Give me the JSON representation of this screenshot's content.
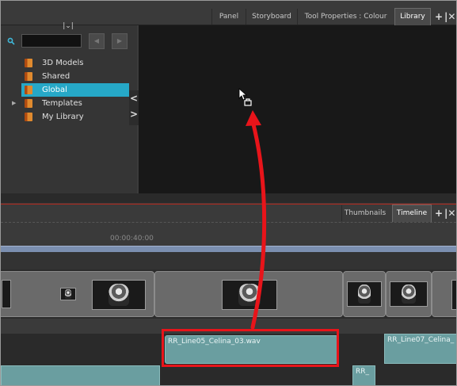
{
  "top_tabs": {
    "panel": "Panel",
    "storyboard": "Storyboard",
    "tool_properties": "Tool Properties : Colour",
    "library": "Library",
    "add_icon": "plus-icon",
    "close_icon": "close-icon"
  },
  "library": {
    "search": {
      "value": "",
      "placeholder": ""
    },
    "tree": [
      {
        "label": "3D Models",
        "icon": "folder-icon",
        "selected": false,
        "expandable": false
      },
      {
        "label": "Shared",
        "icon": "folder-icon",
        "selected": false,
        "expandable": false
      },
      {
        "label": "Global",
        "icon": "folder-icon",
        "selected": true,
        "expandable": false
      },
      {
        "label": "Templates",
        "icon": "folder-icon",
        "selected": false,
        "expandable": true
      },
      {
        "label": "My Library",
        "icon": "folder-icon",
        "selected": false,
        "expandable": false
      }
    ],
    "selection_color": "#26a8c7",
    "collapse_glyphs": {
      "top": "<",
      "bottom": ">"
    }
  },
  "timeline_tabs": {
    "thumbnails": "Thumbnails",
    "timeline": "Timeline",
    "add_icon": "plus-icon",
    "close_icon": "close-icon"
  },
  "timeline": {
    "timecode": "00:00:40:00",
    "audio_clips": [
      {
        "label": "RR_Line05_Celina_03.wav"
      },
      {
        "label": "RR_Line07_Celina_"
      },
      {
        "label": "RR_"
      }
    ]
  },
  "annotation": {
    "highlight_color": "#e8141a",
    "arrow_color": "#e8141a"
  }
}
